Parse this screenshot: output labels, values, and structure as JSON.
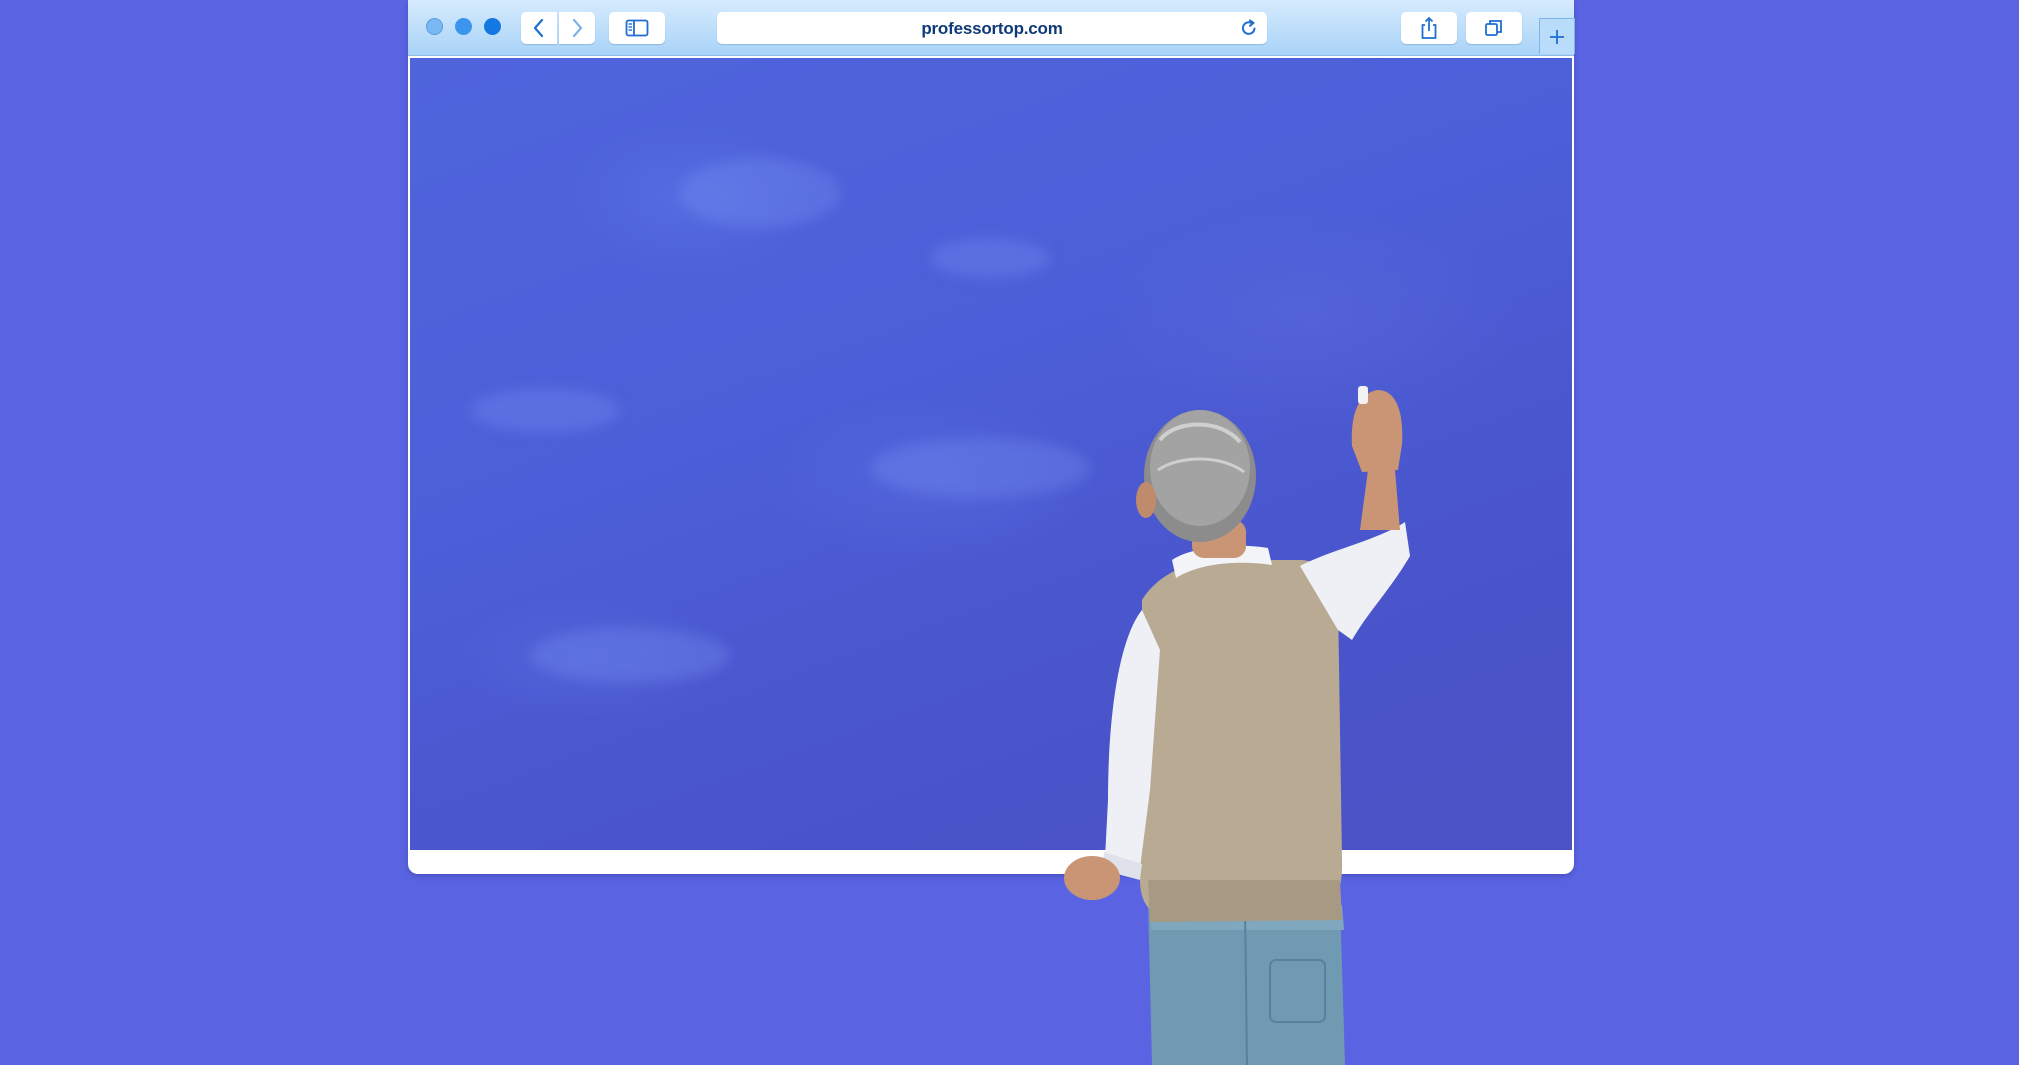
{
  "browser": {
    "url": "professortop.com",
    "icons": {
      "close": "close-dot",
      "minimize": "minimize-dot",
      "zoom": "zoom-dot",
      "back": "chevron-left-icon",
      "forward": "chevron-right-icon",
      "sidebar": "sidebar-icon",
      "reload": "reload-icon",
      "share": "share-icon",
      "tabs": "tabs-icon",
      "new_tab": "plus-icon"
    }
  },
  "colors": {
    "page_background": "#5a64e3",
    "toolbar": "#c2e0fb",
    "url_text": "#0f3a78",
    "chalkboard": "#4c5fd8"
  }
}
